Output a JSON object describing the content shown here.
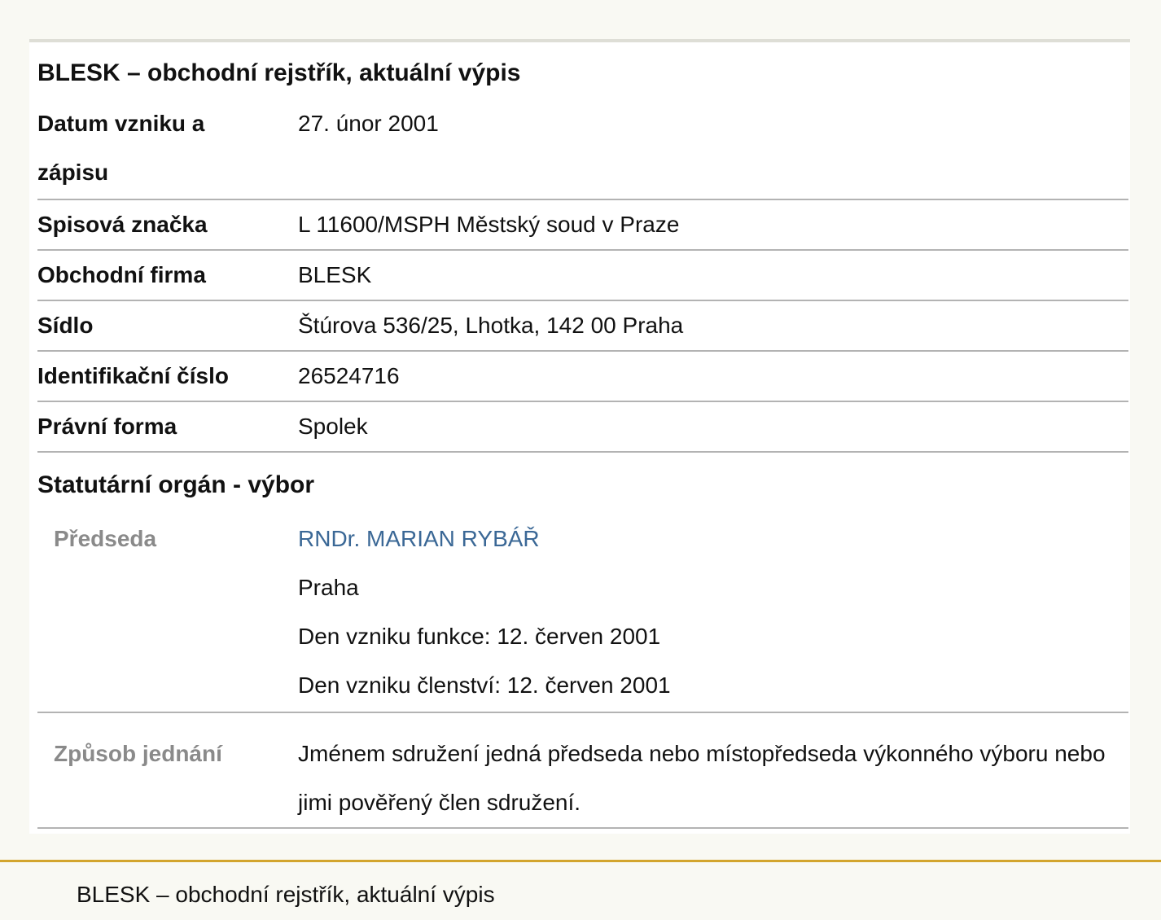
{
  "card": {
    "title": "BLESK – obchodní rejstřík, aktuální výpis",
    "rows": [
      {
        "label": "Datum vzniku a zápisu",
        "value": "27. únor 2001"
      },
      {
        "label": "Spisová značka",
        "value": "L 11600/MSPH Městský soud v Praze"
      },
      {
        "label": "Obchodní firma",
        "value": "BLESK"
      },
      {
        "label": "Sídlo",
        "value": "Štúrova 536/25, Lhotka, 142 00 Praha"
      },
      {
        "label": "Identifikační číslo",
        "value": "26524716"
      },
      {
        "label": "Právní forma",
        "value": "Spolek"
      }
    ]
  },
  "statutory": {
    "title": "Statutární orgán - výbor",
    "chairman": {
      "label": "Předseda",
      "name": "RNDr. MARIAN RYBÁŘ",
      "city": "Praha",
      "function_start": "Den vzniku funkce: 12. červen 2001",
      "membership_start": "Den vzniku členství: 12. červen 2001"
    },
    "conduct": {
      "label": "Způsob jednání",
      "value": "Jménem sdružení jedná předseda nebo místopředseda výkonného výboru nebo jimi pověřený člen sdružení."
    }
  },
  "footer": {
    "text": "BLESK – obchodní rejstřík, aktuální výpis"
  },
  "colors": {
    "link": "#3b6896",
    "footer_accent": "#d3a52d",
    "sub_label": "#8a8a8a",
    "page_background": "#f9f9f3"
  }
}
